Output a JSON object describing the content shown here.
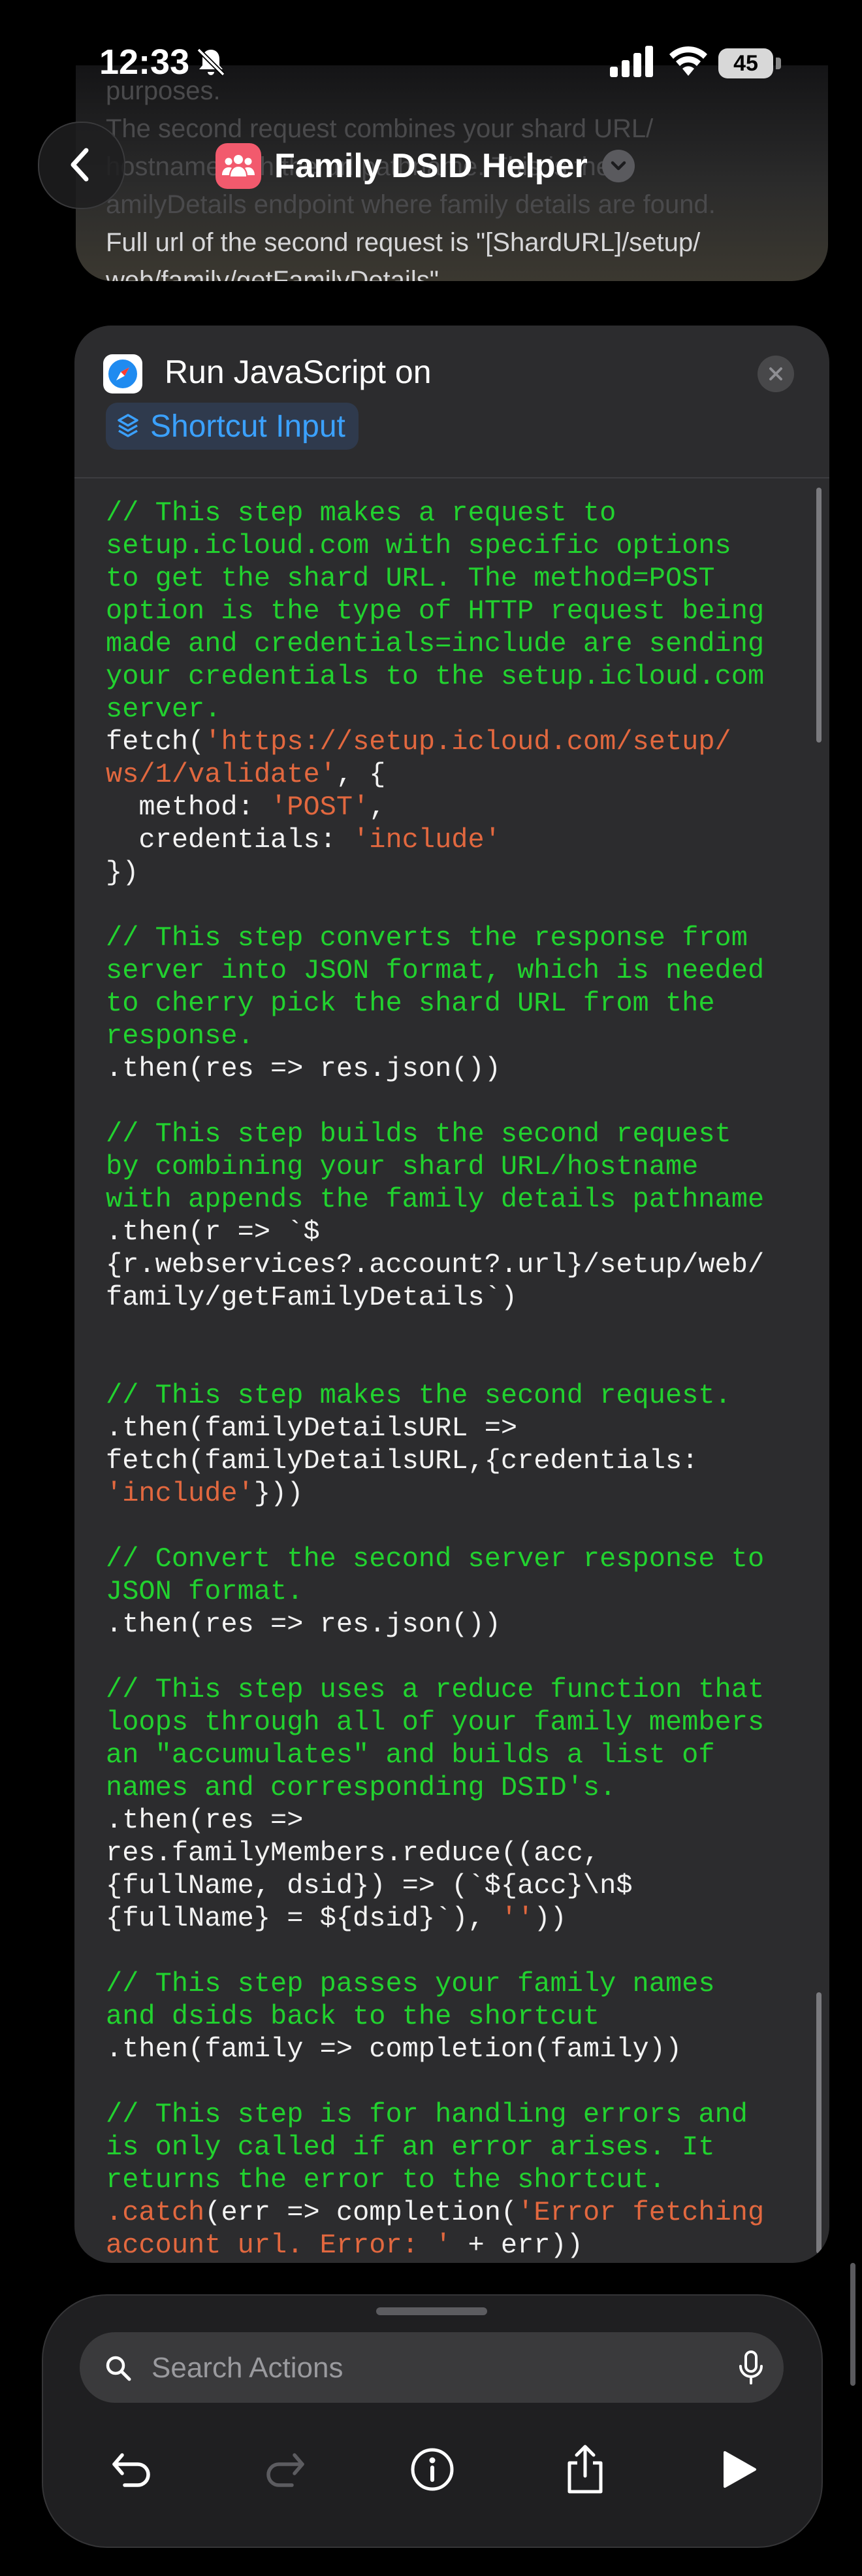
{
  "status_bar": {
    "time": "12:33",
    "battery": "45"
  },
  "header": {
    "description_lines": [
      "purposes.",
      "The second request combines your shard URL/",
      "hostname with the url pathname. This is the",
      "amilyDetails endpoint where family details are found.",
      "Full url of the second request is \"[ShardURL]/setup/",
      "web/family/getFamilyDetails\"."
    ],
    "title": "Family DSID Helper"
  },
  "action": {
    "label": "Run JavaScript on",
    "input_token": "Shortcut Input",
    "code_lines": [
      [
        {
          "t": "c",
          "v": "// This step makes a request to"
        }
      ],
      [
        {
          "t": "c",
          "v": "setup.icloud.com with specific options"
        }
      ],
      [
        {
          "t": "c",
          "v": "to get the shard URL. The method=POST"
        }
      ],
      [
        {
          "t": "c",
          "v": "option is the type of HTTP request being"
        }
      ],
      [
        {
          "t": "c",
          "v": "made and credentials=include are sending"
        }
      ],
      [
        {
          "t": "c",
          "v": "your credentials to the setup.icloud.com"
        }
      ],
      [
        {
          "t": "c",
          "v": "server."
        }
      ],
      [
        {
          "t": "p",
          "v": "fetch("
        },
        {
          "t": "s",
          "v": "'https://setup.icloud.com/setup/"
        }
      ],
      [
        {
          "t": "s",
          "v": "ws/1/validate'"
        },
        {
          "t": "p",
          "v": ", {"
        }
      ],
      [
        {
          "t": "p",
          "v": "  method: "
        },
        {
          "t": "s",
          "v": "'POST'"
        },
        {
          "t": "p",
          "v": ","
        }
      ],
      [
        {
          "t": "p",
          "v": "  credentials: "
        },
        {
          "t": "s",
          "v": "'include'"
        }
      ],
      [
        {
          "t": "p",
          "v": "})"
        }
      ],
      [],
      [
        {
          "t": "c",
          "v": "// This step converts the response from"
        }
      ],
      [
        {
          "t": "c",
          "v": "server into JSON format, which is needed"
        }
      ],
      [
        {
          "t": "c",
          "v": "to cherry pick the shard URL from the"
        }
      ],
      [
        {
          "t": "c",
          "v": "response."
        }
      ],
      [
        {
          "t": "p",
          "v": ".then(res => res.json())"
        }
      ],
      [],
      [
        {
          "t": "c",
          "v": "// This step builds the second request"
        }
      ],
      [
        {
          "t": "c",
          "v": "by combining your shard URL/hostname"
        }
      ],
      [
        {
          "t": "c",
          "v": "with appends the family details pathname"
        }
      ],
      [
        {
          "t": "p",
          "v": ".then(r => `$"
        }
      ],
      [
        {
          "t": "p",
          "v": "{r.webservices?.account?.url}/setup/web/"
        }
      ],
      [
        {
          "t": "p",
          "v": "family/getFamilyDetails`)"
        }
      ],
      [],
      [],
      [
        {
          "t": "c",
          "v": "// This step makes the second request."
        }
      ],
      [
        {
          "t": "p",
          "v": ".then(familyDetailsURL =>"
        }
      ],
      [
        {
          "t": "p",
          "v": "fetch(familyDetailsURL,{credentials:"
        }
      ],
      [
        {
          "t": "s",
          "v": "'include'"
        },
        {
          "t": "p",
          "v": "}))"
        }
      ],
      [],
      [
        {
          "t": "c",
          "v": "// Convert the second server response to"
        }
      ],
      [
        {
          "t": "c",
          "v": "JSON format."
        }
      ],
      [
        {
          "t": "p",
          "v": ".then(res => res.json())"
        }
      ],
      [],
      [
        {
          "t": "c",
          "v": "// This step uses a reduce function that"
        }
      ],
      [
        {
          "t": "c",
          "v": "loops through all of your family members"
        }
      ],
      [
        {
          "t": "c",
          "v": "an \"accumulates\" and builds a list of"
        }
      ],
      [
        {
          "t": "c",
          "v": "names and corresponding DSID's."
        }
      ],
      [
        {
          "t": "p",
          "v": ".then(res =>"
        }
      ],
      [
        {
          "t": "p",
          "v": "res.familyMembers.reduce((acc,"
        }
      ],
      [
        {
          "t": "p",
          "v": "{fullName, dsid}) => (`${acc}\\n$"
        }
      ],
      [
        {
          "t": "p",
          "v": "{fullName} = ${dsid}`), "
        },
        {
          "t": "s",
          "v": "''"
        },
        {
          "t": "p",
          "v": "))"
        }
      ],
      [],
      [
        {
          "t": "c",
          "v": "// This step passes your family names"
        }
      ],
      [
        {
          "t": "c",
          "v": "and dsids back to the shortcut"
        }
      ],
      [
        {
          "t": "p",
          "v": ".then(family => completion(family))"
        }
      ],
      [],
      [
        {
          "t": "c",
          "v": "// This step is for handling errors and"
        }
      ],
      [
        {
          "t": "c",
          "v": "is only called if an error arises. It"
        }
      ],
      [
        {
          "t": "c",
          "v": "returns the error to the shortcut."
        }
      ],
      [
        {
          "t": "s",
          "v": ".catch"
        },
        {
          "t": "p",
          "v": "(err => completion("
        },
        {
          "t": "s",
          "v": "'Error fetching"
        }
      ],
      [
        {
          "t": "s",
          "v": "account url. Error: '"
        },
        {
          "t": "p",
          "v": " + err))"
        }
      ]
    ]
  },
  "bottom_sheet": {
    "search_placeholder": "Search Actions"
  },
  "colors": {
    "comment": "#22d22f",
    "string": "#e2683f",
    "plain": "#f2f2f2",
    "link": "#3ba1ff",
    "app_icon": "#f25a6d"
  },
  "icons": {
    "status": [
      "bell-slash-icon",
      "signal-icon",
      "wifi-icon",
      "battery-icon"
    ],
    "toolbar": [
      "undo-icon",
      "redo-icon",
      "info-icon",
      "share-icon",
      "play-icon"
    ]
  }
}
